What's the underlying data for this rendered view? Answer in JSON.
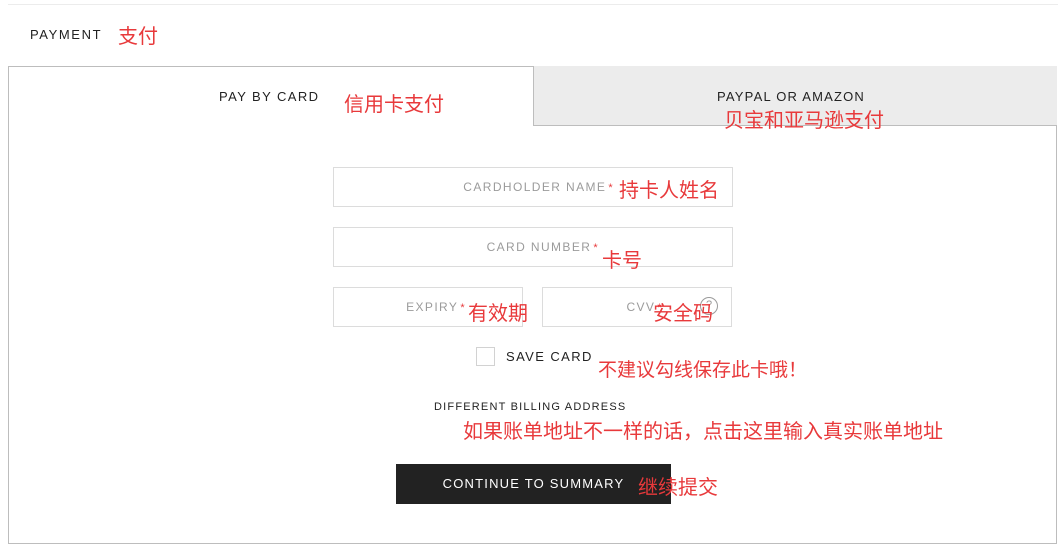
{
  "header": {
    "title": "PAYMENT"
  },
  "tabs": [
    {
      "label": "PAY BY CARD",
      "active": true
    },
    {
      "label": "PAYPAL OR AMAZON",
      "active": false
    }
  ],
  "form": {
    "cardholder_name": {
      "placeholder": "CARDHOLDER NAME",
      "required_mark": "*"
    },
    "card_number": {
      "placeholder": "CARD NUMBER",
      "required_mark": "*"
    },
    "expiry": {
      "placeholder": "EXPIRY",
      "required_mark": "*"
    },
    "cvv": {
      "placeholder": "CVV",
      "required_mark": "*",
      "help_icon": "?"
    },
    "save_card": {
      "label": "SAVE CARD",
      "checked": false
    },
    "billing_link": "DIFFERENT BILLING ADDRESS",
    "submit_label": "CONTINUE TO SUMMARY"
  },
  "annotations": {
    "payment": "支付",
    "pay_by_card": "信用卡支付",
    "paypal_amazon": "贝宝和亚马逊支付",
    "cardholder_name": "持卡人姓名",
    "card_number": "卡号",
    "expiry": "有效期",
    "cvv": "安全码",
    "save_card": "不建议勾线保存此卡哦！",
    "billing": "如果账单地址不一样的话，点击这里输入真实账单地址",
    "continue": "继续提交"
  },
  "colors": {
    "annotation": "#e8393b",
    "button_bg": "#222222",
    "inactive_tab_bg": "#ececec",
    "border": "#bdbdbd",
    "placeholder": "#9b9b9b"
  }
}
